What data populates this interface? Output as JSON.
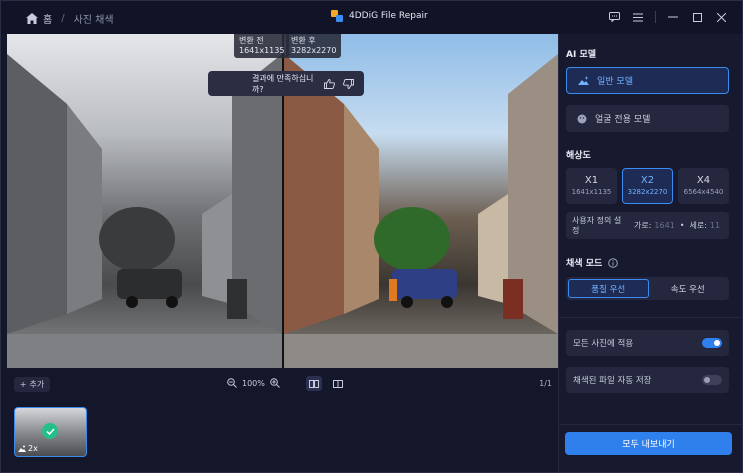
{
  "titlebar": {
    "home_label": "홈",
    "breadcrumb_current": "사진 채색",
    "app_title": "4DDiG File Repair"
  },
  "preview": {
    "before_label": "변환 전",
    "before_size": "1641x1135",
    "after_label": "변환 후",
    "after_size": "3282x2270",
    "feedback_question": "결과에 만족하십니까?"
  },
  "toolbar": {
    "add_label": "추가",
    "zoom_level": "100%",
    "page_count": "1/1"
  },
  "thumbnail": {
    "scale_tag": "2x"
  },
  "panel": {
    "ai_model_title": "AI 모델",
    "general_model": "일반 모델",
    "face_model": "얼굴 전용 모델",
    "resolution_title": "해상도",
    "resolutions": [
      {
        "label": "X1",
        "size": "1641x1135"
      },
      {
        "label": "X2",
        "size": "3282x2270"
      },
      {
        "label": "X4",
        "size": "6564x4540"
      }
    ],
    "selected_resolution": "X2",
    "custom_label": "사용자 정의 설정",
    "width_label": "가로:",
    "width_value": "1641",
    "height_label": "세로:",
    "height_value": "11",
    "color_mode_title": "채색 모드",
    "quality_first": "품질 우선",
    "speed_first": "속도 우선",
    "apply_all": "모든 사진에 적용",
    "apply_all_on": true,
    "auto_save": "채색된 파일 자동 저장",
    "auto_save_on": false,
    "export_all": "모두 내보내기"
  },
  "colors": {
    "accent": "#2f80ed",
    "panel_bg": "#171a2e",
    "active_text": "#6fb2ff"
  }
}
